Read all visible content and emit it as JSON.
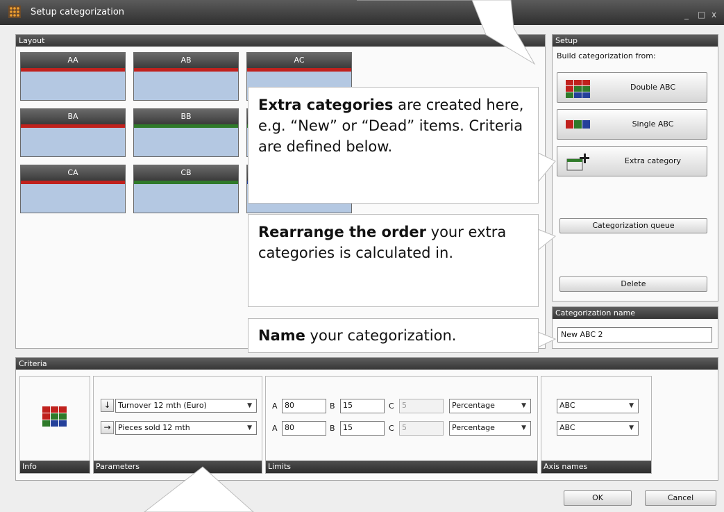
{
  "window": {
    "title": "Setup categorization",
    "controls": [
      "_",
      "□",
      "x"
    ]
  },
  "layout": {
    "header": "Layout",
    "tiles": [
      {
        "label": "AA",
        "bar": "#c0211d"
      },
      {
        "label": "AB",
        "bar": "#c0211d"
      },
      {
        "label": "AC",
        "bar": "#c0211d"
      },
      {
        "label": "BA",
        "bar": "#c0211d"
      },
      {
        "label": "BB",
        "bar": "#2f7a2a"
      },
      {
        "label": "",
        "bar": "#2f7a2a"
      },
      {
        "label": "CA",
        "bar": "#c0211d"
      },
      {
        "label": "CB",
        "bar": "#2f7a2a"
      },
      {
        "label": "",
        "bar": "#24409a"
      }
    ]
  },
  "setup": {
    "header": "Setup",
    "subtitle": "Build categorization from:",
    "double_abc": "Double ABC",
    "single_abc": "Single ABC",
    "extra_category": "Extra category",
    "queue": "Categorization queue",
    "delete": "Delete"
  },
  "catname": {
    "header": "Categorization name",
    "value": "New ABC 2"
  },
  "criteria": {
    "header": "Criteria",
    "info_label": "Info",
    "parameters_label": "Parameters",
    "limits_label": "Limits",
    "axis_label": "Axis names",
    "param1": {
      "arrow": "↓",
      "value": "Turnover 12 mth  (Euro)"
    },
    "param2": {
      "arrow": "→",
      "value": "Pieces sold 12 mth"
    },
    "limits": [
      {
        "a_label": "A",
        "a": "80",
        "b_label": "B",
        "b": "15",
        "c_label": "C",
        "c": "5",
        "mode": "Percentage"
      },
      {
        "a_label": "A",
        "a": "80",
        "b_label": "B",
        "b": "15",
        "c_label": "C",
        "c": "5",
        "mode": "Percentage"
      }
    ],
    "axis1": "ABC",
    "axis2": "ABC"
  },
  "footer": {
    "ok": "OK",
    "cancel": "Cancel"
  },
  "callouts": {
    "extra_bold": "Extra categories",
    "extra_rest": " are created here, e.g. “New” or “Dead” items. Criteria are defined below.",
    "order_bold": "Rearrange the order",
    "order_rest": " your extra categories is calculated in.",
    "name_bold": "Name",
    "name_rest": " your categorization."
  },
  "colors": {
    "red": "#c0211d",
    "green": "#2f7a2a",
    "blue": "#24409a",
    "tile_body": "#b4c8e2"
  }
}
